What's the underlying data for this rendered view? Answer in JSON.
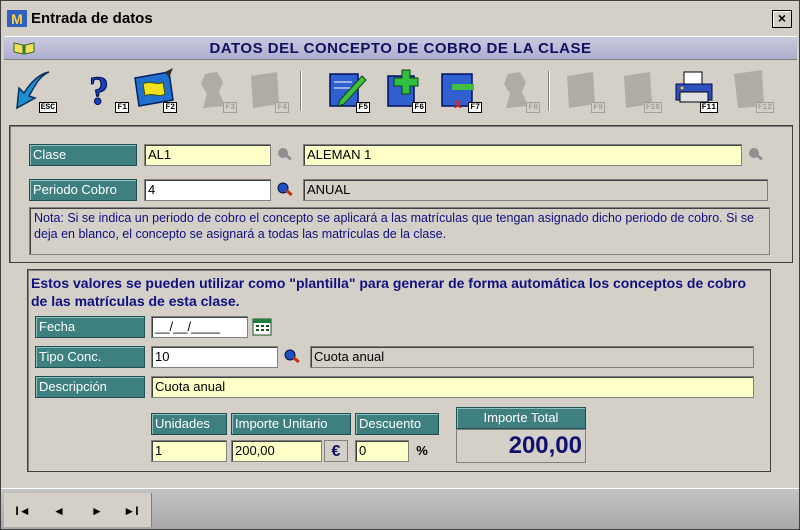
{
  "window": {
    "title": "Entrada de datos",
    "close_label": "×",
    "banner_title": "DATOS DEL CONCEPTO DE COBRO DE LA CLASE"
  },
  "toolbar": {
    "buttons": [
      {
        "icon": "exit-icon",
        "key": "ESC",
        "enabled": true
      },
      {
        "icon": "help-icon",
        "key": "F1",
        "enabled": true
      },
      {
        "icon": "map-icon",
        "key": "F2",
        "enabled": true
      },
      {
        "icon": "person-icon",
        "key": "F3",
        "enabled": false
      },
      {
        "icon": "document-icon",
        "key": "F4",
        "enabled": false
      },
      {
        "icon": "edit-icon",
        "key": "F5",
        "enabled": true
      },
      {
        "icon": "new-record-icon",
        "key": "F6",
        "enabled": true
      },
      {
        "icon": "delete-record-icon",
        "key": "F7",
        "enabled": true
      },
      {
        "icon": "person-icon",
        "key": "F8",
        "enabled": false
      },
      {
        "icon": "document-icon",
        "key": "F9",
        "enabled": false
      },
      {
        "icon": "document-icon",
        "key": "F10",
        "enabled": false
      },
      {
        "icon": "printer-icon",
        "key": "F11",
        "enabled": true
      },
      {
        "icon": "document-icon",
        "key": "F12",
        "enabled": false
      }
    ]
  },
  "clase": {
    "label": "Clase",
    "code": "AL1",
    "name": "ALEMAN 1"
  },
  "periodo": {
    "label": "Periodo Cobro",
    "code": "4",
    "name": "ANUAL"
  },
  "note": "Nota: Si se indica un periodo de cobro el concepto se aplicará a las matrículas que tengan asignado dicho periodo de cobro. Si se deja en blanco, el concepto se asignará a todas las matrículas de la clase.",
  "plantilla": {
    "title": "Estos valores se pueden utilizar como \"plantilla\" para generar de forma automática los conceptos de cobro de las matrículas de esta clase.",
    "fecha_label": "Fecha",
    "fecha_value": "__/__/____",
    "tipo_label": "Tipo Conc.",
    "tipo_code": "10",
    "tipo_name": "Cuota anual",
    "desc_label": "Descripción",
    "desc_value": "Cuota anual",
    "unidades_label": "Unidades",
    "unidades_value": "1",
    "importe_label": "Importe Unitario",
    "importe_value": "200,00",
    "currency_symbol": "€",
    "descuento_label": "Descuento",
    "descuento_value": "0",
    "percent_symbol": "%",
    "total_label": "Importe Total",
    "total_value": "200,00"
  },
  "nav": {
    "first": "I◄",
    "prev": "◄",
    "next": "►",
    "last": "►I"
  },
  "colors": {
    "label_bg": "#3e7f80",
    "yellow_field": "#ffffc8",
    "accent_text": "#101080"
  }
}
